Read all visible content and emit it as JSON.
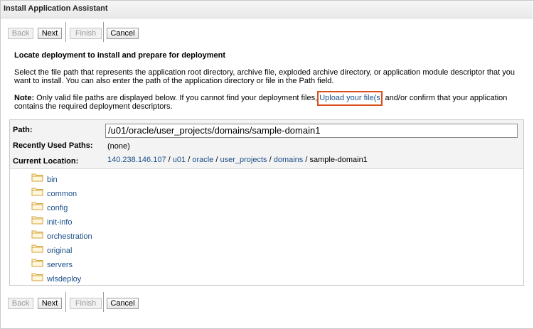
{
  "window": {
    "title": "Install Application Assistant"
  },
  "buttons": {
    "back": "Back",
    "next": "Next",
    "finish": "Finish",
    "cancel": "Cancel"
  },
  "section": {
    "heading": "Locate deployment to install and prepare for deployment",
    "description": "Select the file path that represents the application root directory, archive file, exploded archive directory, or application module descriptor that you want to install. You can also enter the path of the application directory or file in the Path field.",
    "note_label": "Note:",
    "note_before": " Only valid file paths are displayed below. If you cannot find your deployment files, ",
    "note_link": "Upload your file(s)",
    "note_after": " and/or confirm that your application contains the required deployment descriptors."
  },
  "form": {
    "path_label": "Path:",
    "path_value": "/u01/oracle/user_projects/domains/sample-domain1",
    "recent_label": "Recently Used Paths:",
    "recent_value": "(none)",
    "location_label": "Current Location:",
    "breadcrumb": [
      "140.238.146.107",
      "u01",
      "oracle",
      "user_projects",
      "domains"
    ],
    "breadcrumb_current": "sample-domain1",
    "separator": "/"
  },
  "folders": [
    "bin",
    "common",
    "config",
    "init-info",
    "orchestration",
    "original",
    "servers",
    "wlsdeploy"
  ],
  "colors": {
    "link": "#1b4f8a",
    "highlight": "#d9501e",
    "folder": "#e8b84a"
  }
}
